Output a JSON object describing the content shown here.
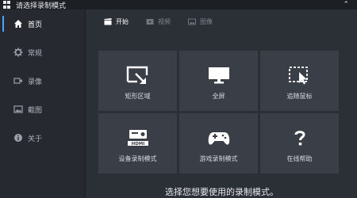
{
  "window": {
    "title": "请选择录制模式"
  },
  "sidebar": {
    "items": [
      {
        "label": "首页",
        "icon": "home-icon"
      },
      {
        "label": "常规",
        "icon": "gear-icon"
      },
      {
        "label": "录像",
        "icon": "video-camera-icon"
      },
      {
        "label": "截图",
        "icon": "image-icon"
      },
      {
        "label": "关于",
        "icon": "info-icon"
      }
    ]
  },
  "tabs": [
    {
      "label": "开始",
      "icon": "clapperboard-icon"
    },
    {
      "label": "视频",
      "icon": "video-icon"
    },
    {
      "label": "图像",
      "icon": "image-icon"
    }
  ],
  "tiles": [
    {
      "label": "矩形区域",
      "icon": "rectangle-select-icon"
    },
    {
      "label": "全屏",
      "icon": "monitor-icon"
    },
    {
      "label": "追随鼠标",
      "icon": "cursor-follow-icon"
    },
    {
      "label": "设备录制模式",
      "icon": "hdmi-icon"
    },
    {
      "label": "游戏录制模式",
      "icon": "gamepad-icon"
    },
    {
      "label": "在线帮助",
      "icon": "help-icon"
    }
  ],
  "footer": {
    "text": "选择您想要使用的录制模式。"
  },
  "colors": {
    "accent": "#4aa3ff",
    "background": "#2b2f36",
    "tile": "#3a3f47",
    "sidebar": "#262a30"
  }
}
